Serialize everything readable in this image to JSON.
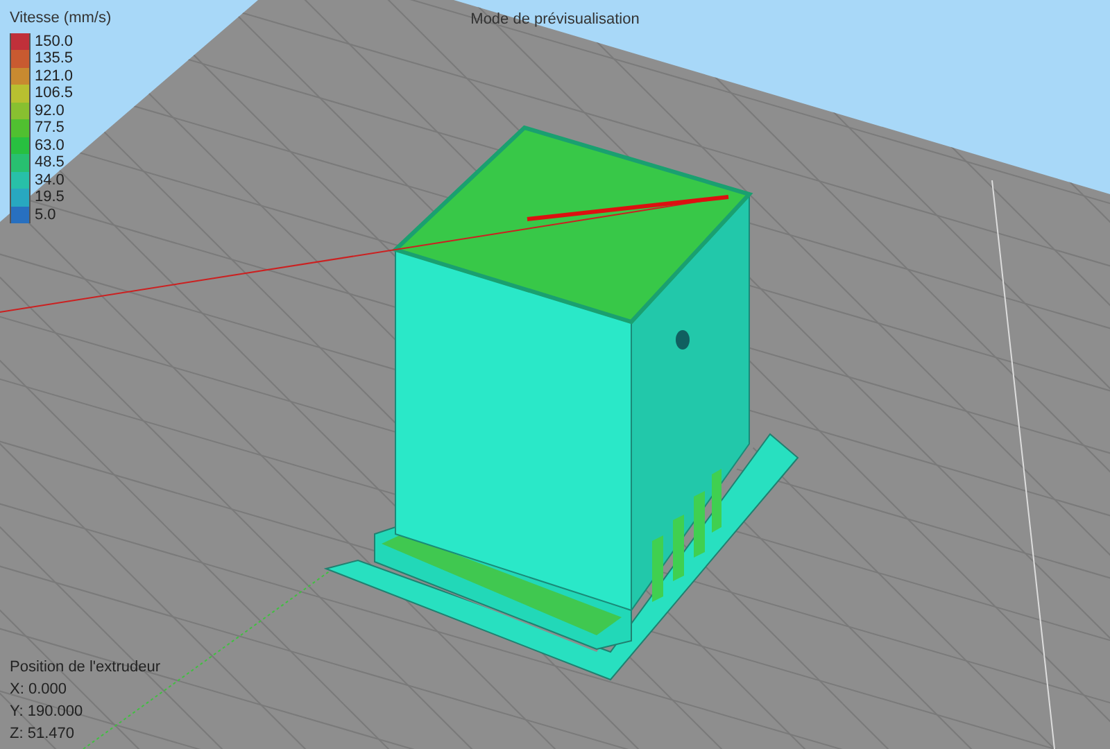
{
  "title": "Mode de prévisualisation",
  "legend": {
    "title": "Vitesse (mm/s)",
    "items": [
      {
        "label": "150.0",
        "color": "#c0303a"
      },
      {
        "label": "135.5",
        "color": "#c85a30"
      },
      {
        "label": "121.0",
        "color": "#c88a30"
      },
      {
        "label": "106.5",
        "color": "#b8c030"
      },
      {
        "label": "92.0",
        "color": "#88c030"
      },
      {
        "label": "77.5",
        "color": "#50c030"
      },
      {
        "label": "63.0",
        "color": "#28c040"
      },
      {
        "label": "48.5",
        "color": "#28c070"
      },
      {
        "label": "34.0",
        "color": "#28c0a8"
      },
      {
        "label": "19.5",
        "color": "#28a8c0"
      },
      {
        "label": "5.0",
        "color": "#2870c0"
      }
    ]
  },
  "extruder": {
    "title": "Position de l'extrudeur",
    "lines": [
      "X: 0.000",
      "Y: 190.000",
      "Z: 51.470"
    ]
  }
}
